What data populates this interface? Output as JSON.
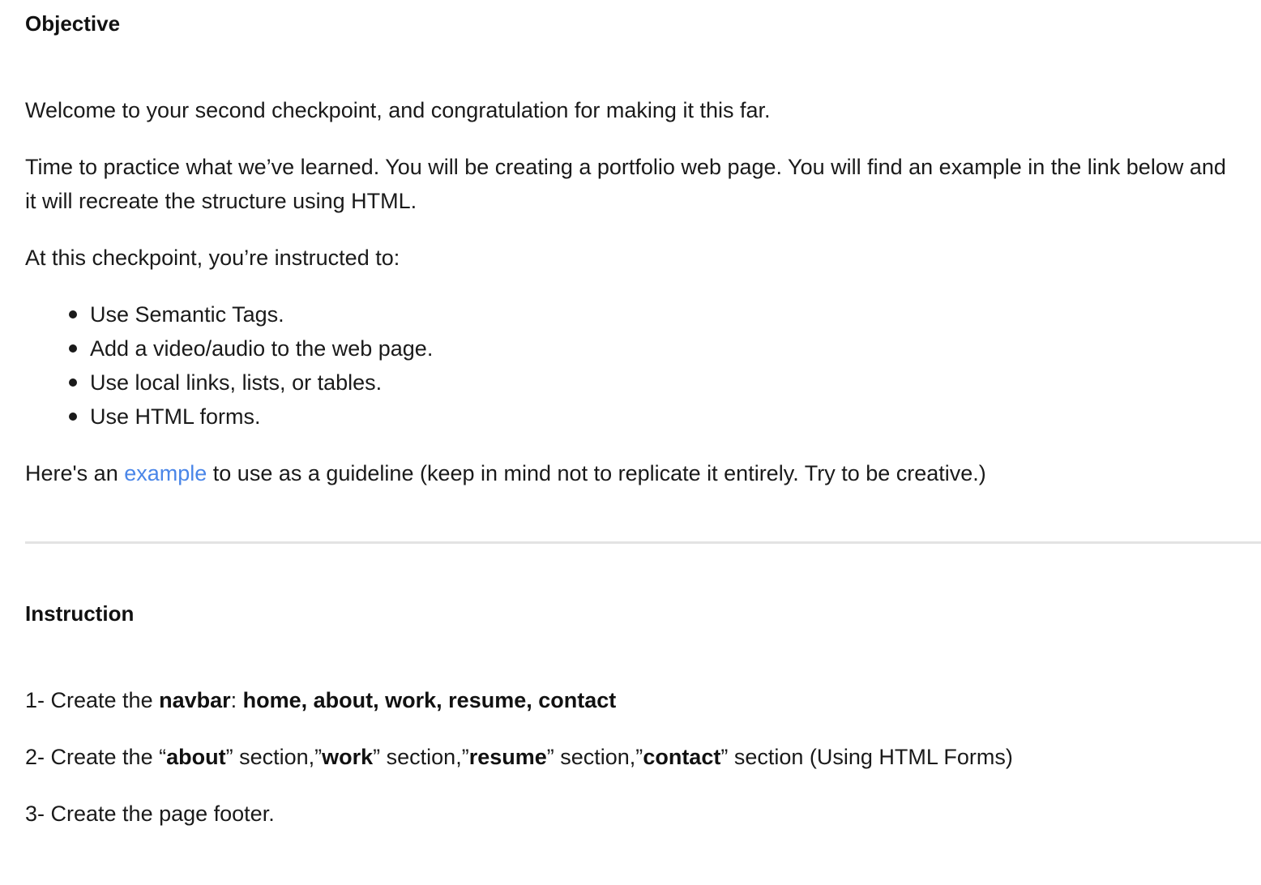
{
  "objective": {
    "heading": "Objective",
    "welcome": "Welcome to your second checkpoint, and congratulation for making it this far.",
    "practice": "Time to practice what we’ve learned.  You will be creating a portfolio web page. You will find an example in the link below and it will recreate the structure using HTML.",
    "instructed": "At this checkpoint, you’re instructed to:",
    "bullets": [
      "Use Semantic Tags.",
      "Add a video/audio to the web page.",
      "Use local links, lists, or tables.",
      "Use HTML forms."
    ],
    "guideline": {
      "before": "Here's an ",
      "link": "example",
      "after": " to use as a guideline (keep in mind not to replicate it entirely. Try to be creative.)"
    }
  },
  "instruction": {
    "heading": "Instruction",
    "step1": {
      "prefix": "1- Create the ",
      "navbar": "navbar",
      "colon": ": ",
      "items": "home, about, work, resume, contact"
    },
    "step2": {
      "prefix": "2- Create the “",
      "about": "about",
      "mid1": "” section,”",
      "work": "work",
      "mid2": "” section,”",
      "resume": "resume",
      "mid3": "” section,”",
      "contact": "contact",
      "suffix": "” section (Using HTML Forms)"
    },
    "step3": "3- Create the page footer."
  },
  "colors": {
    "link": "#4a86e8",
    "divider": "#e3e3e3",
    "text": "#1a1a1a"
  }
}
